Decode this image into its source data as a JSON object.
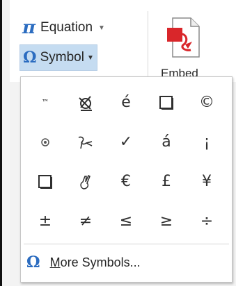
{
  "ribbon": {
    "equation": {
      "label": "Equation",
      "icon": "pi-icon",
      "glyph": "π"
    },
    "symbol": {
      "label": "Symbol",
      "icon": "omega-icon",
      "glyph": "Ω"
    },
    "embed": {
      "label": "Embed",
      "icon": "pdf-embed-icon"
    }
  },
  "symbol_gallery": {
    "rows": [
      [
        "™",
        "",
        "é",
        "",
        "©"
      ],
      [
        "",
        "",
        "✓",
        "á",
        "¡"
      ],
      [
        "",
        "",
        "€",
        "£",
        "¥"
      ],
      [
        "±",
        "≠",
        "≤",
        "≥",
        "÷"
      ]
    ],
    "more": {
      "glyph": "Ω",
      "mnemonic": "M",
      "rest": "ore Symbols..."
    }
  },
  "colors": {
    "accent_blue": "#2b6cc0",
    "selected_bg": "#c5dcf1",
    "pdf_red": "#d9262a"
  }
}
